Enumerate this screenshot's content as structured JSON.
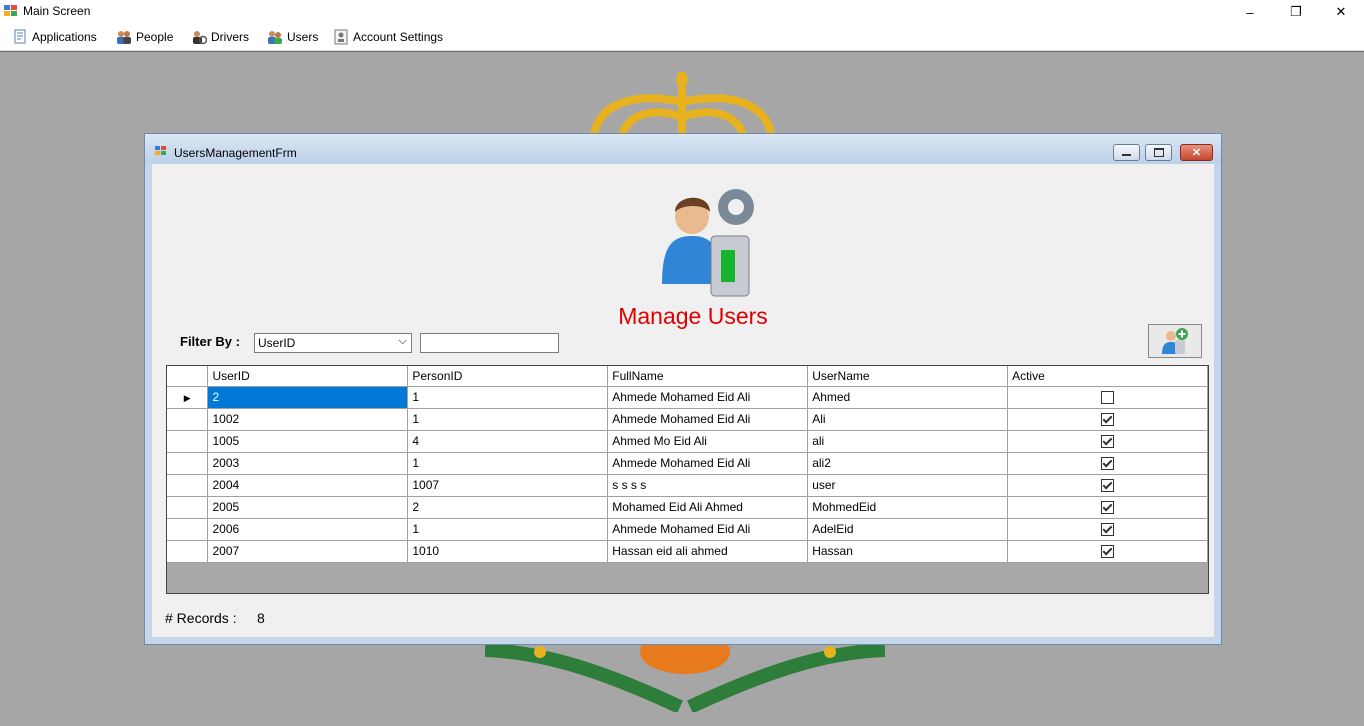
{
  "main_window": {
    "title": "Main Screen",
    "controls": {
      "minimize": "–",
      "restore": "❐",
      "close": "✕"
    }
  },
  "menu": [
    {
      "label": "Applications",
      "icon": "applications-icon"
    },
    {
      "label": "People",
      "icon": "people-icon"
    },
    {
      "label": "Drivers",
      "icon": "drivers-icon"
    },
    {
      "label": "Users",
      "icon": "users-icon"
    },
    {
      "label": "Account Settings",
      "icon": "account-settings-icon"
    }
  ],
  "form": {
    "title": "UsersManagementFrm",
    "heading": "Manage Users",
    "filter": {
      "label": "Filter By :",
      "selected": "UserID",
      "value": ""
    },
    "grid": {
      "columns": [
        "UserID",
        "PersonID",
        "FullName",
        "UserName",
        "Active"
      ],
      "rows": [
        {
          "user_id": "2",
          "person_id": "1",
          "full_name": "Ahmede Mohamed Eid Ali",
          "user_name": "Ahmed",
          "active": false
        },
        {
          "user_id": "1002",
          "person_id": "1",
          "full_name": "Ahmede Mohamed Eid Ali",
          "user_name": "Ali",
          "active": true
        },
        {
          "user_id": "1005",
          "person_id": "4",
          "full_name": "Ahmed Mo Eid Ali",
          "user_name": "ali",
          "active": true
        },
        {
          "user_id": "2003",
          "person_id": "1",
          "full_name": "Ahmede Mohamed Eid Ali",
          "user_name": "ali2",
          "active": true
        },
        {
          "user_id": "2004",
          "person_id": "1007",
          "full_name": "s s s s",
          "user_name": "user",
          "active": true
        },
        {
          "user_id": "2005",
          "person_id": "2",
          "full_name": "Mohamed Eid Ali Ahmed",
          "user_name": "MohmedEid",
          "active": true
        },
        {
          "user_id": "2006",
          "person_id": "1",
          "full_name": "Ahmede Mohamed Eid Ali",
          "user_name": "AdelEid",
          "active": true
        },
        {
          "user_id": "2007",
          "person_id": "1010",
          "full_name": "Hassan eid ali ahmed",
          "user_name": "Hassan",
          "active": true
        }
      ],
      "selected_row": 0
    },
    "records": {
      "label": "# Records :",
      "count": "8"
    }
  },
  "colors": {
    "heading": "#e00000",
    "selection": "#0078d7",
    "background": "#a6a6a6"
  }
}
